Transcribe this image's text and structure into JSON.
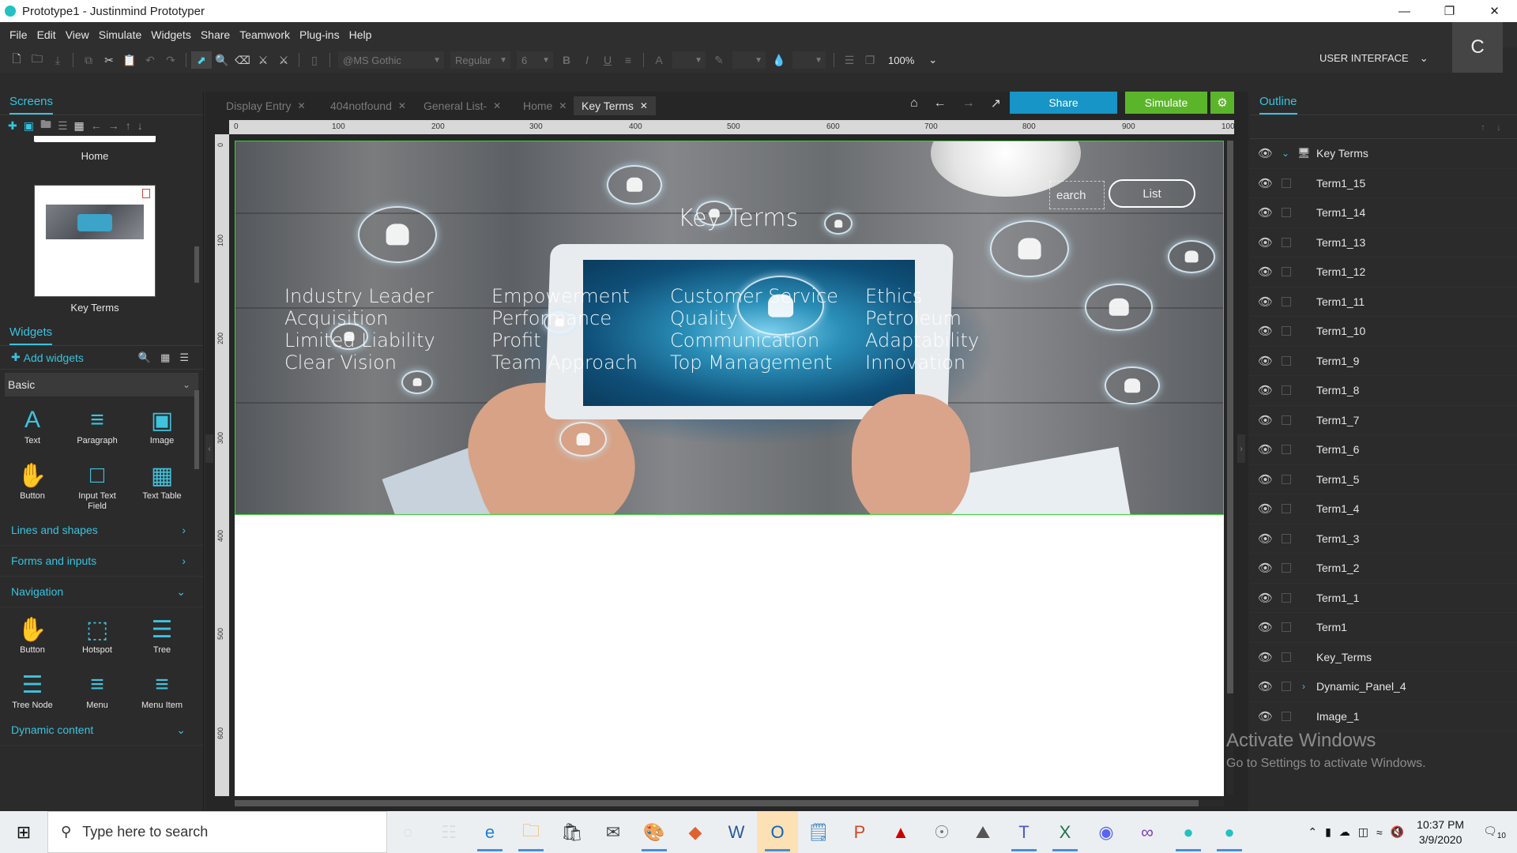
{
  "window": {
    "title": "Prototype1 - Justinmind Prototyper"
  },
  "menu": [
    "File",
    "Edit",
    "View",
    "Simulate",
    "Widgets",
    "Share",
    "Teamwork",
    "Plug-ins",
    "Help"
  ],
  "toolbar": {
    "font": "@MS Gothic",
    "style": "Regular",
    "size": "6",
    "zoom": "100%",
    "perspective": "USER INTERFACE",
    "user_initial": "C"
  },
  "screens": {
    "header": "Screens",
    "items": [
      {
        "label": "Home"
      },
      {
        "label": "Key Terms"
      }
    ]
  },
  "widgets": {
    "header": "Widgets",
    "add_label": "Add widgets",
    "category": "Basic",
    "basic": [
      "Text",
      "Paragraph",
      "Image",
      "Button",
      "Input Text Field",
      "Text Table"
    ],
    "sections": [
      "Lines and shapes",
      "Forms and inputs",
      "Navigation"
    ],
    "navigation": [
      "Button",
      "Hotspot",
      "Tree",
      "Tree Node",
      "Menu",
      "Menu Item"
    ],
    "last_section": "Dynamic content"
  },
  "tabs": [
    {
      "label": "Display Entry",
      "active": false
    },
    {
      "label": "404notfound",
      "active": false
    },
    {
      "label": "General List-",
      "active": false
    },
    {
      "label": "Home",
      "active": false
    },
    {
      "label": "Key Terms",
      "active": true
    }
  ],
  "actions": {
    "share": "Share",
    "simulate": "Simulate"
  },
  "ruler": {
    "top": [
      "0",
      "100",
      "200",
      "300",
      "400",
      "500",
      "600",
      "700",
      "800",
      "900",
      "100"
    ],
    "left": [
      "0",
      "100",
      "200",
      "300",
      "400",
      "500",
      "600"
    ]
  },
  "canvas": {
    "title": "Key Terms",
    "search_label": "earch",
    "list_label": "List",
    "columns": [
      [
        "Industry Leader",
        "Acquisition",
        "Limited Liability",
        "Clear Vision"
      ],
      [
        "Empowerment",
        "Performance",
        "Profit",
        "Team Approach"
      ],
      [
        "Customer Service",
        "Quality",
        "Communication",
        "Top Management"
      ],
      [
        "Ethics",
        "Petroleum",
        "Adaptability",
        "Innovation"
      ]
    ]
  },
  "outline": {
    "header": "Outline",
    "items": [
      "Key Terms",
      "Term1_15",
      "Term1_14",
      "Term1_13",
      "Term1_12",
      "Term1_11",
      "Term1_10",
      "Term1_9",
      "Term1_8",
      "Term1_7",
      "Term1_6",
      "Term1_5",
      "Term1_4",
      "Term1_3",
      "Term1_2",
      "Term1_1",
      "Term1",
      "Key_Terms",
      "Dynamic_Panel_4",
      "Image_1"
    ]
  },
  "activation": {
    "line1": "Activate Windows",
    "line2": "Go to Settings to activate Windows."
  },
  "taskbar": {
    "search_placeholder": "Type here to search",
    "time": "10:37 PM",
    "date": "3/9/2020",
    "notifications": "10"
  },
  "colors": {
    "accent": "#36c4e0",
    "share": "#1695c6",
    "simulate": "#5bb52a"
  }
}
